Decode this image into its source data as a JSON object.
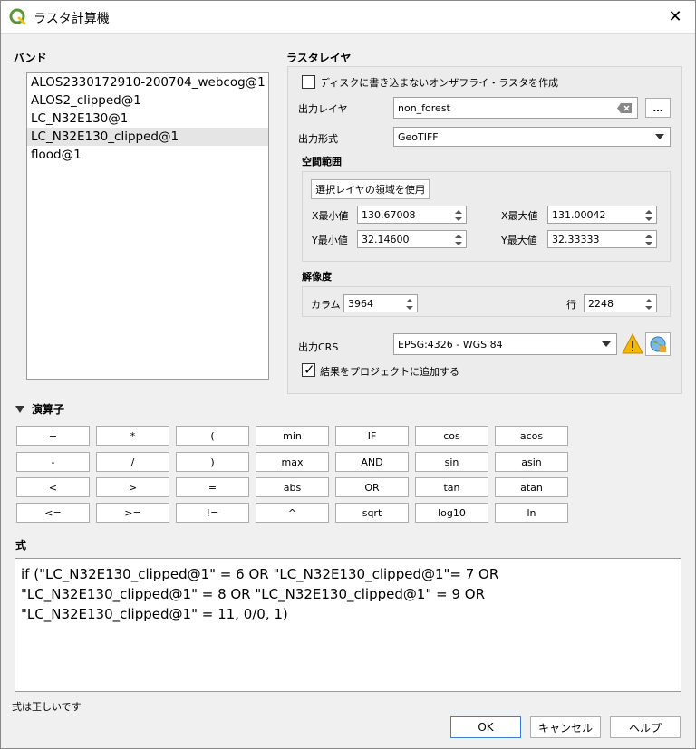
{
  "window": {
    "title": "ラスタ計算機",
    "close_label": "✕"
  },
  "bands": {
    "header": "バンド",
    "items": [
      "ALOS2330172910-200704_webcog@1",
      "ALOS2_clipped@1",
      "LC_N32E130@1",
      "LC_N32E130_clipped@1",
      "flood@1"
    ]
  },
  "raster_layer": {
    "header": "ラスタレイヤ",
    "on_the_fly_label": "ディスクに書き込まないオンザフライ・ラスタを作成",
    "output_layer_label": "出力レイヤ",
    "output_layer_value": "non_forest",
    "browse_label": "…",
    "output_format_label": "出力形式",
    "output_format_value": "GeoTIFF",
    "extent_header": "空間範囲",
    "use_selected_extent_label": "選択レイヤの領域を使用",
    "xmin_label": "X最小値",
    "xmin_value": "130.67008",
    "xmax_label": "X最大値",
    "xmax_value": "131.00042",
    "ymin_label": "Y最小値",
    "ymin_value": "32.14600",
    "ymax_label": "Y最大値",
    "ymax_value": "32.33333",
    "resolution_header": "解像度",
    "columns_label": "カラム",
    "columns_value": "3964",
    "rows_label": "行",
    "rows_value": "2248",
    "crs_label": "出力CRS",
    "crs_value": "EPSG:4326 - WGS 84",
    "add_to_project_label": "結果をプロジェクトに追加する"
  },
  "operators": {
    "header": "演算子",
    "rows": [
      [
        "+",
        "*",
        "(",
        "min",
        "IF",
        "cos",
        "acos"
      ],
      [
        "-",
        "/",
        ")",
        "max",
        "AND",
        "sin",
        "asin"
      ],
      [
        "<",
        ">",
        "=",
        "abs",
        "OR",
        "tan",
        "atan"
      ],
      [
        "<=",
        ">=",
        "!=",
        "^",
        "sqrt",
        "log10",
        "ln"
      ]
    ]
  },
  "expression": {
    "header": "式",
    "lines": [
      "if (\"LC_N32E130_clipped@1\" = 6 OR \"LC_N32E130_clipped@1\"= 7 OR",
      "\"LC_N32E130_clipped@1\" = 8 OR \"LC_N32E130_clipped@1\" = 9 OR",
      "\"LC_N32E130_clipped@1\" = 11, 0/0, 1)"
    ],
    "status": "式は正しいです"
  },
  "buttons": {
    "ok": "OK",
    "cancel": "キャンセル",
    "help": "ヘルプ"
  },
  "colors": {
    "qgis_green": "#589632",
    "warning_yellow": "#f5b800"
  }
}
